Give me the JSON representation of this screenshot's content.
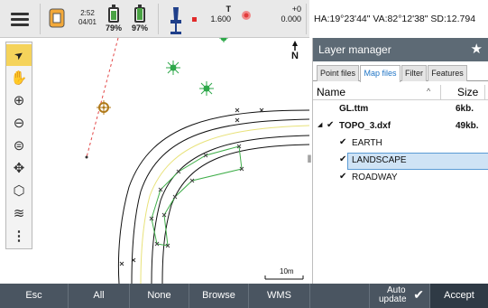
{
  "statusbar": {
    "time": "2:52",
    "date": "04/01",
    "battery1": "79%",
    "battery1_level": 0.79,
    "battery2": "97%",
    "battery2_level": 0.97,
    "target_label": "T",
    "target_height": "1.600",
    "offset_top": "+0",
    "offset_value": "0.000",
    "angles": "HA:19°23'44\"  VA:82°12'38\"  SD:12.794"
  },
  "toolbar": {
    "tools": [
      {
        "name": "select-arrow-icon",
        "glyph": "➤"
      },
      {
        "name": "pan-hand-icon",
        "glyph": "✋"
      },
      {
        "name": "zoom-in-icon",
        "glyph": "⊕"
      },
      {
        "name": "zoom-out-icon",
        "glyph": "⊖"
      },
      {
        "name": "zoom-extents-icon",
        "glyph": "⊜"
      },
      {
        "name": "orbit-icon",
        "glyph": "✥"
      },
      {
        "name": "3d-view-icon",
        "glyph": "⬡"
      },
      {
        "name": "layers-icon",
        "glyph": "≋"
      },
      {
        "name": "more-icon",
        "glyph": "⋮"
      }
    ]
  },
  "map": {
    "north_label": "N",
    "scale_label": "10m"
  },
  "panel": {
    "title": "Layer manager",
    "tabs": [
      "Point files",
      "Map files",
      "Filter",
      "Features"
    ],
    "active_tab": "Map files",
    "col_name": "Name",
    "col_size": "Size",
    "rows": [
      {
        "name": "GL.ttm",
        "size": "6kb",
        "level": 0,
        "checked": false
      },
      {
        "name": "TOPO_3.dxf",
        "size": "49kb",
        "level": 0,
        "checked": true,
        "expanded": true
      },
      {
        "name": "EARTH",
        "level": 1,
        "checked": true
      },
      {
        "name": "LANDSCAPE",
        "level": 1,
        "checked": true,
        "selected": true
      },
      {
        "name": "ROADWAY",
        "level": 1,
        "checked": true
      }
    ],
    "size_suffix": "."
  },
  "bottombar": {
    "esc": "Esc",
    "all": "All",
    "none": "None",
    "browse": "Browse",
    "wms": "WMS",
    "auto_update_line1": "Auto",
    "auto_update_line2": "update",
    "accept": "Accept"
  },
  "colors": {
    "accent": "#f5d35b",
    "panel_header": "#5d6a75",
    "bottombar": "#4a5561",
    "tab_active_text": "#1e74c5",
    "selection": "#cfe3f5",
    "road_line": "#111111",
    "road_center": "#e8e27a",
    "landscape": "#3fae49",
    "guide_line": "#e34848"
  }
}
